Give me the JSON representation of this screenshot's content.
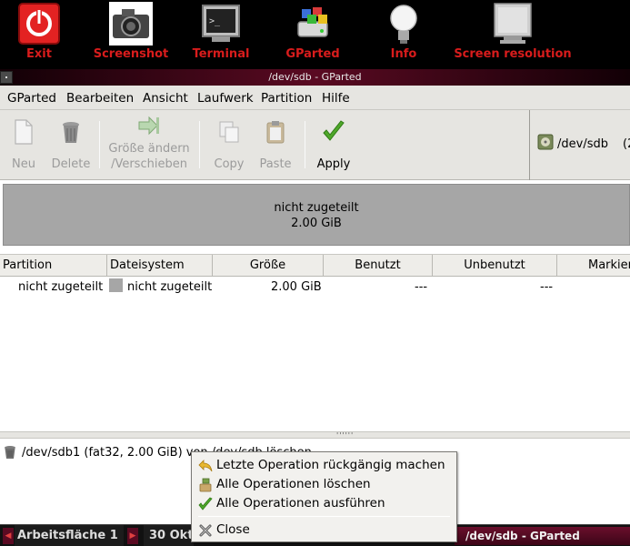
{
  "launcher": {
    "items": [
      {
        "label": "Exit",
        "icon": "power-icon"
      },
      {
        "label": "Screenshot",
        "icon": "camera-icon"
      },
      {
        "label": "Terminal",
        "icon": "terminal-icon"
      },
      {
        "label": "GParted",
        "icon": "gparted-icon"
      },
      {
        "label": "Info",
        "icon": "lightbulb-icon"
      },
      {
        "label": "Screen resolution",
        "icon": "monitor-icon"
      }
    ],
    "label_color": "#d81c1c"
  },
  "window": {
    "title": "/dev/sdb - GParted"
  },
  "menubar": {
    "items": [
      {
        "label": "GParted"
      },
      {
        "label": "Bearbeiten"
      },
      {
        "label": "Ansicht"
      },
      {
        "label": "Laufwerk"
      },
      {
        "label": "Partition"
      },
      {
        "label": "Hilfe"
      }
    ]
  },
  "toolbar": {
    "new": "Neu",
    "delete": "Delete",
    "resize_line1": "Größe ändern",
    "resize_line2": "/Verschieben",
    "copy": "Copy",
    "paste": "Paste",
    "apply": "Apply",
    "device": "/dev/sdb",
    "device_extra": "(2"
  },
  "diskmap": {
    "name": "nicht zugeteilt",
    "size": "2.00 GiB"
  },
  "table": {
    "headers": [
      "Partition",
      "Dateisystem",
      "Größe",
      "Benutzt",
      "Unbenutzt",
      "Markier"
    ],
    "rows": [
      {
        "partition": "nicht zugeteilt",
        "filesystem": "nicht zugeteilt",
        "size": "2.00 GiB",
        "used": "---",
        "unused": "---"
      }
    ]
  },
  "operations": {
    "items": [
      {
        "text": "/dev/sdb1 (fat32, 2.00 GiB) von /dev/sdb löschen"
      }
    ]
  },
  "context_menu": {
    "undo": "Letzte Operation rückgängig machen",
    "clear": "Alle Operationen löschen",
    "apply": "Alle Operationen ausführen",
    "close": "Close"
  },
  "taskbar": {
    "workspace": "Arbeitsfläche 1",
    "clock": "30 Okt,",
    "task": "/dev/sdb - GParted"
  },
  "colors": {
    "accent_red": "#d81c1c",
    "titlebar": "#5a0a22",
    "panel_bg": "#e6e5e1",
    "disk_unallocated": "#a6a6a6"
  }
}
